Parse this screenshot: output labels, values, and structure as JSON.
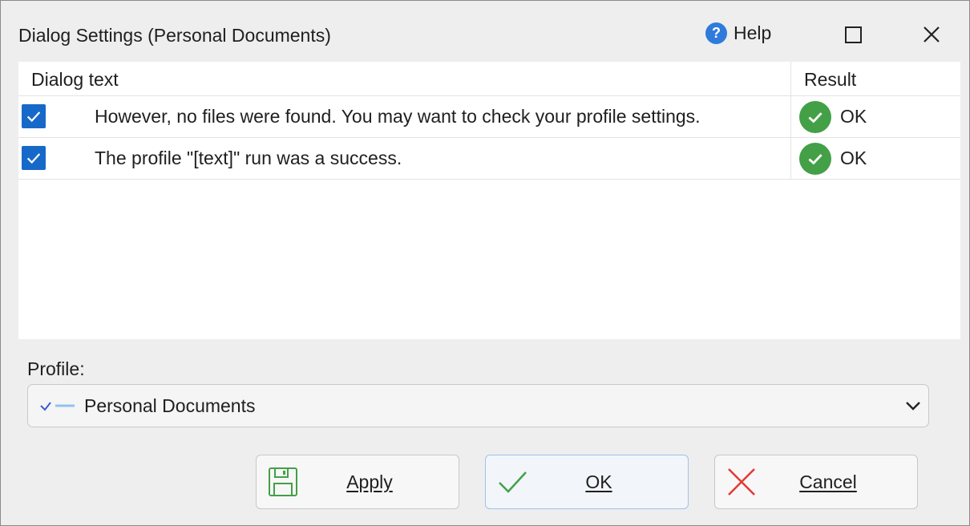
{
  "window": {
    "title": "Dialog Settings (Personal Documents)",
    "help_label": "Help",
    "help_icon": "help-circle-icon",
    "maximize_icon": "maximize-icon",
    "close_icon": "close-icon"
  },
  "table": {
    "headers": {
      "dialog_text": "Dialog text",
      "result": "Result"
    },
    "rows": [
      {
        "checked": true,
        "text": "However, no files were found. You may want to check your profile settings.",
        "result": "OK",
        "result_icon": "check-circle-icon"
      },
      {
        "checked": true,
        "text": "The profile \"[text]\" run was a success.",
        "result": "OK",
        "result_icon": "check-circle-icon"
      }
    ]
  },
  "profile": {
    "label": "Profile:",
    "selected": "Personal Documents",
    "selected_icon": "check-line-icon"
  },
  "buttons": {
    "apply": "Apply",
    "ok": "OK",
    "cancel": "Cancel"
  },
  "colors": {
    "accent": "#1769c9",
    "success": "#43a047",
    "help": "#2f7bdc",
    "cancel_icon": "#e53935",
    "ok_icon": "#43a047"
  }
}
